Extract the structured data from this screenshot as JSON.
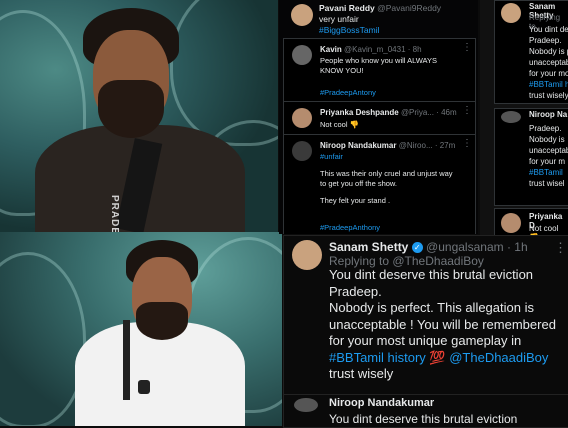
{
  "tweets_main": [
    {
      "name": "Pavani Reddy",
      "handle": "@Pavani9Reddy",
      "lines": [
        "very unfair"
      ],
      "tags": [
        "#BiggBossTamil"
      ]
    },
    {
      "name": "Kavin",
      "handle": "@Kavin_m_0431 · 8h",
      "lines": [
        "People who know you will ALWAYS",
        "KNOW YOU!"
      ],
      "tags": [
        "#PradeepAntony"
      ]
    },
    {
      "name": "Priyanka Deshpande",
      "handle": "@Priya... · 46m",
      "lines": [
        "Not cool 👎"
      ],
      "tags": []
    },
    {
      "name": "Niroop Nandakumar",
      "handle": "@Niroo... · 27m",
      "lines": [
        "This was their only cruel and unjust way",
        "to get you off the show.",
        "They felt your stand ."
      ],
      "tags": [
        "#unfair",
        "#PradeepAnthony"
      ]
    }
  ],
  "tweets_right": [
    {
      "name": "Sanam Shetty",
      "sub": "Replying to",
      "lines": [
        "You dint deserve this brutal eviction",
        "Pradeep.",
        "Nobody is perfect. This allegation is",
        "unacceptable ! You will be remembered",
        "for your most unique gameplay in",
        "#BBTamil history 💯 @TheDhaadiBoy",
        "trust wisely"
      ]
    },
    {
      "name": "Niroop Na",
      "lines": [
        "Pradeep.",
        "Nobody is",
        "unacceptab",
        "for your m",
        "#BBTamil",
        "trust wisel"
      ]
    },
    {
      "name": "Priyanka D",
      "lines": [
        "Not cool 👎"
      ]
    }
  ],
  "big_tweet": {
    "name": "Sanam Shetty",
    "handle": "@ungalsanam · 1h",
    "replying": "Replying to @TheDhaadiBoy",
    "lines": [
      "You dint deserve this brutal eviction",
      "Pradeep.",
      "Nobody is perfect. This allegation is",
      "unacceptable ! You will be remembered",
      "for your most unique gameplay in",
      "#BBTamil history 💯 @TheDhaadiBoy",
      "trust wisely"
    ]
  },
  "bottom_tweet": {
    "name": "Niroop Nandakumar",
    "lines": [
      "You dint deserve this brutal eviction"
    ]
  },
  "shirt_text": "PRADE"
}
